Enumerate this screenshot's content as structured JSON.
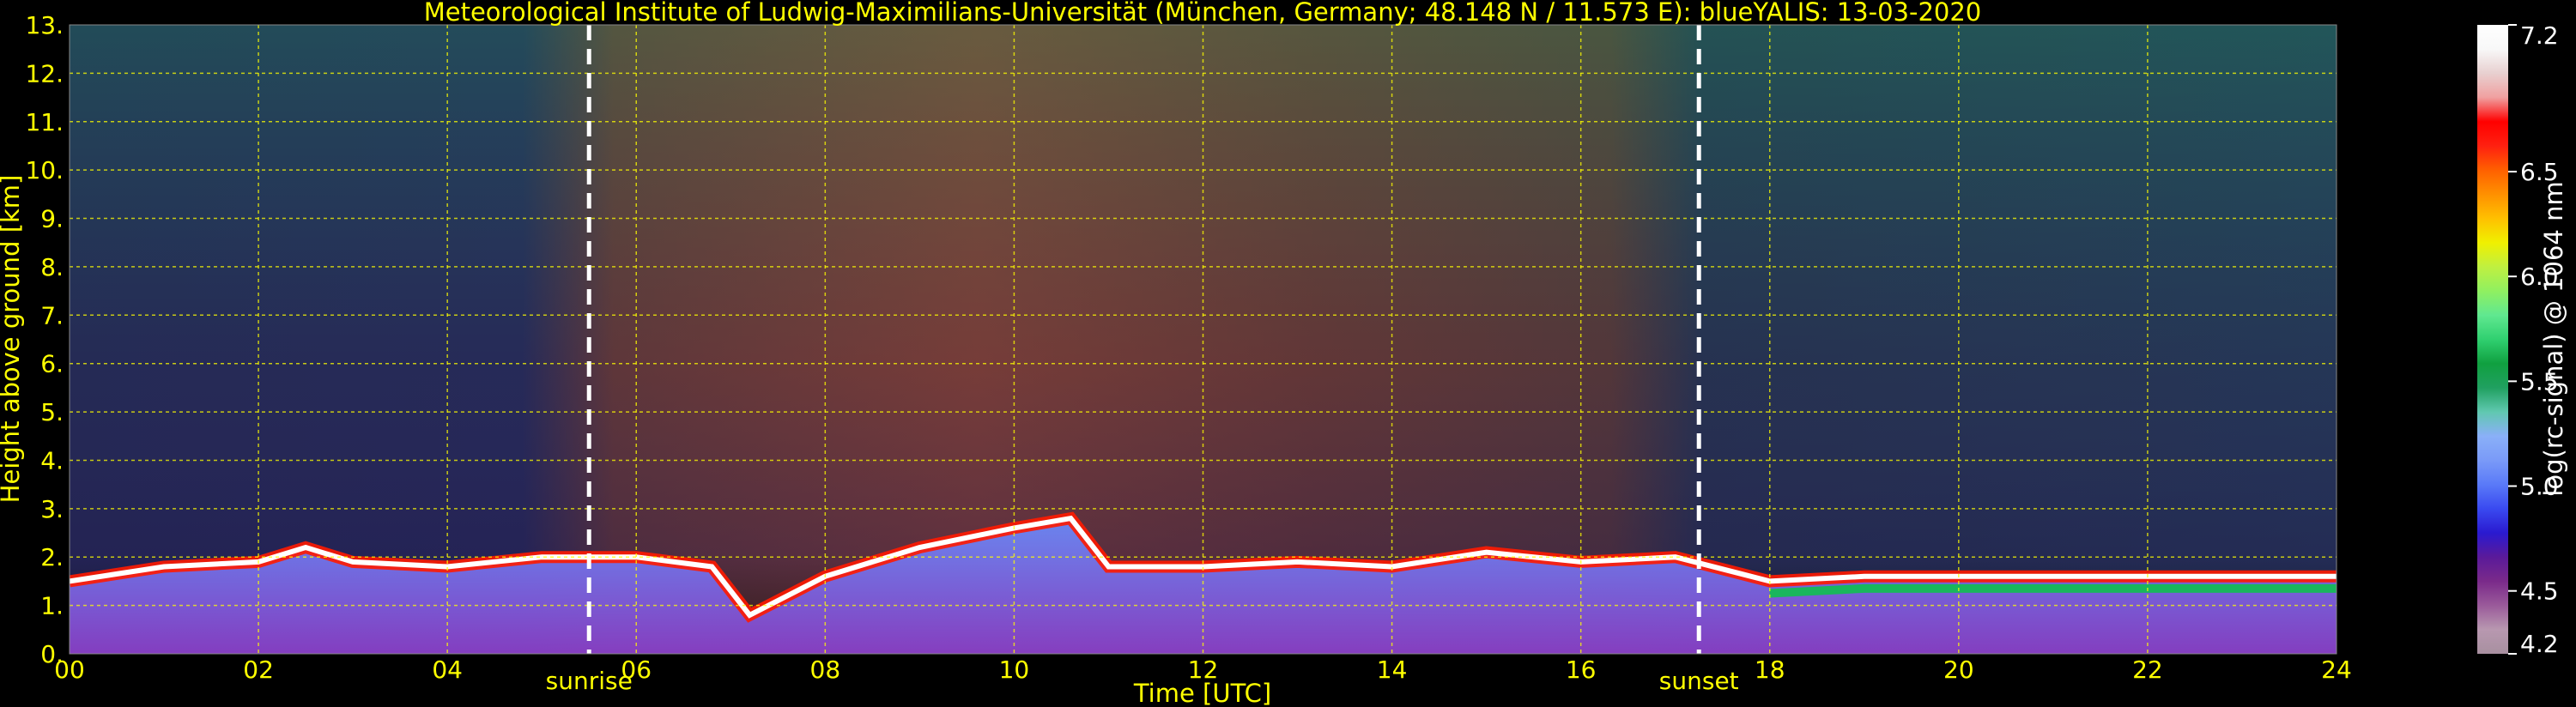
{
  "chart_data": {
    "type": "heatmap",
    "title": "Meteorological Institute of Ludwig-Maximilians-Universität (München, Germany; 48.148 N / 11.573 E):    blueYALIS: 13-03-2020",
    "xlabel": "Time [UTC]",
    "ylabel": "Height above ground [km]",
    "xlim": [
      0,
      24
    ],
    "ylim": [
      0,
      13
    ],
    "x_ticks": [
      "00",
      "02",
      "04",
      "06",
      "08",
      "10",
      "12",
      "14",
      "16",
      "18",
      "20",
      "22",
      "24"
    ],
    "y_ticks": [
      "0.",
      "1.",
      "2.",
      "3.",
      "4.",
      "5.",
      "6.",
      "7.",
      "8.",
      "9.",
      "10.",
      "11.",
      "12.",
      "13."
    ],
    "grid": true,
    "grid_color": "#ffff00",
    "annotations": [
      {
        "text": "sunrise",
        "x": 5.5
      },
      {
        "text": "sunset",
        "x": 17.25
      }
    ],
    "colorbar": {
      "label": "log(rc-signal) @ 1064 nm",
      "min": 4.2,
      "max": 7.2,
      "ticks": [
        "4.2",
        "4.5",
        "5.0",
        "5.5",
        "6.0",
        "6.5",
        "7.2"
      ],
      "tick_values": [
        4.2,
        4.5,
        5.0,
        5.5,
        6.0,
        6.5,
        7.2
      ],
      "colors": [
        "#a890a0",
        "#b898b0",
        "#9a5a9a",
        "#7a2a8a",
        "#5a1a9a",
        "#2a1ad0",
        "#3a4af0",
        "#5a7af8",
        "#7a9af8",
        "#8ab0f8",
        "#60c8b0",
        "#20a060",
        "#10a040",
        "#30d070",
        "#60e890",
        "#90f060",
        "#c0f040",
        "#f0f000",
        "#ffc000",
        "#ff9000",
        "#ff6000",
        "#ff2010",
        "#ff0000",
        "#f0a0a0",
        "#e8d0d0",
        "#f8f8f8",
        "#ffffff"
      ]
    },
    "cloud_base_height_km": [
      {
        "x": 0.0,
        "y": 1.5
      },
      {
        "x": 1.0,
        "y": 1.8
      },
      {
        "x": 2.0,
        "y": 1.9
      },
      {
        "x": 2.5,
        "y": 2.2
      },
      {
        "x": 3.0,
        "y": 1.9
      },
      {
        "x": 4.0,
        "y": 1.8
      },
      {
        "x": 5.0,
        "y": 2.0
      },
      {
        "x": 6.0,
        "y": 2.0
      },
      {
        "x": 6.8,
        "y": 1.8
      },
      {
        "x": 7.2,
        "y": 0.8
      },
      {
        "x": 8.0,
        "y": 1.6
      },
      {
        "x": 9.0,
        "y": 2.2
      },
      {
        "x": 10.0,
        "y": 2.6
      },
      {
        "x": 10.6,
        "y": 2.8
      },
      {
        "x": 11.0,
        "y": 1.8
      },
      {
        "x": 12.0,
        "y": 1.8
      },
      {
        "x": 13.0,
        "y": 1.9
      },
      {
        "x": 14.0,
        "y": 1.8
      },
      {
        "x": 15.0,
        "y": 2.1
      },
      {
        "x": 16.0,
        "y": 1.9
      },
      {
        "x": 17.0,
        "y": 2.0
      },
      {
        "x": 18.0,
        "y": 1.5
      },
      {
        "x": 19.0,
        "y": 1.6
      },
      {
        "x": 20.0,
        "y": 1.6
      },
      {
        "x": 21.0,
        "y": 1.6
      },
      {
        "x": 22.0,
        "y": 1.6
      },
      {
        "x": 23.0,
        "y": 1.6
      },
      {
        "x": 24.0,
        "y": 1.6
      }
    ]
  }
}
